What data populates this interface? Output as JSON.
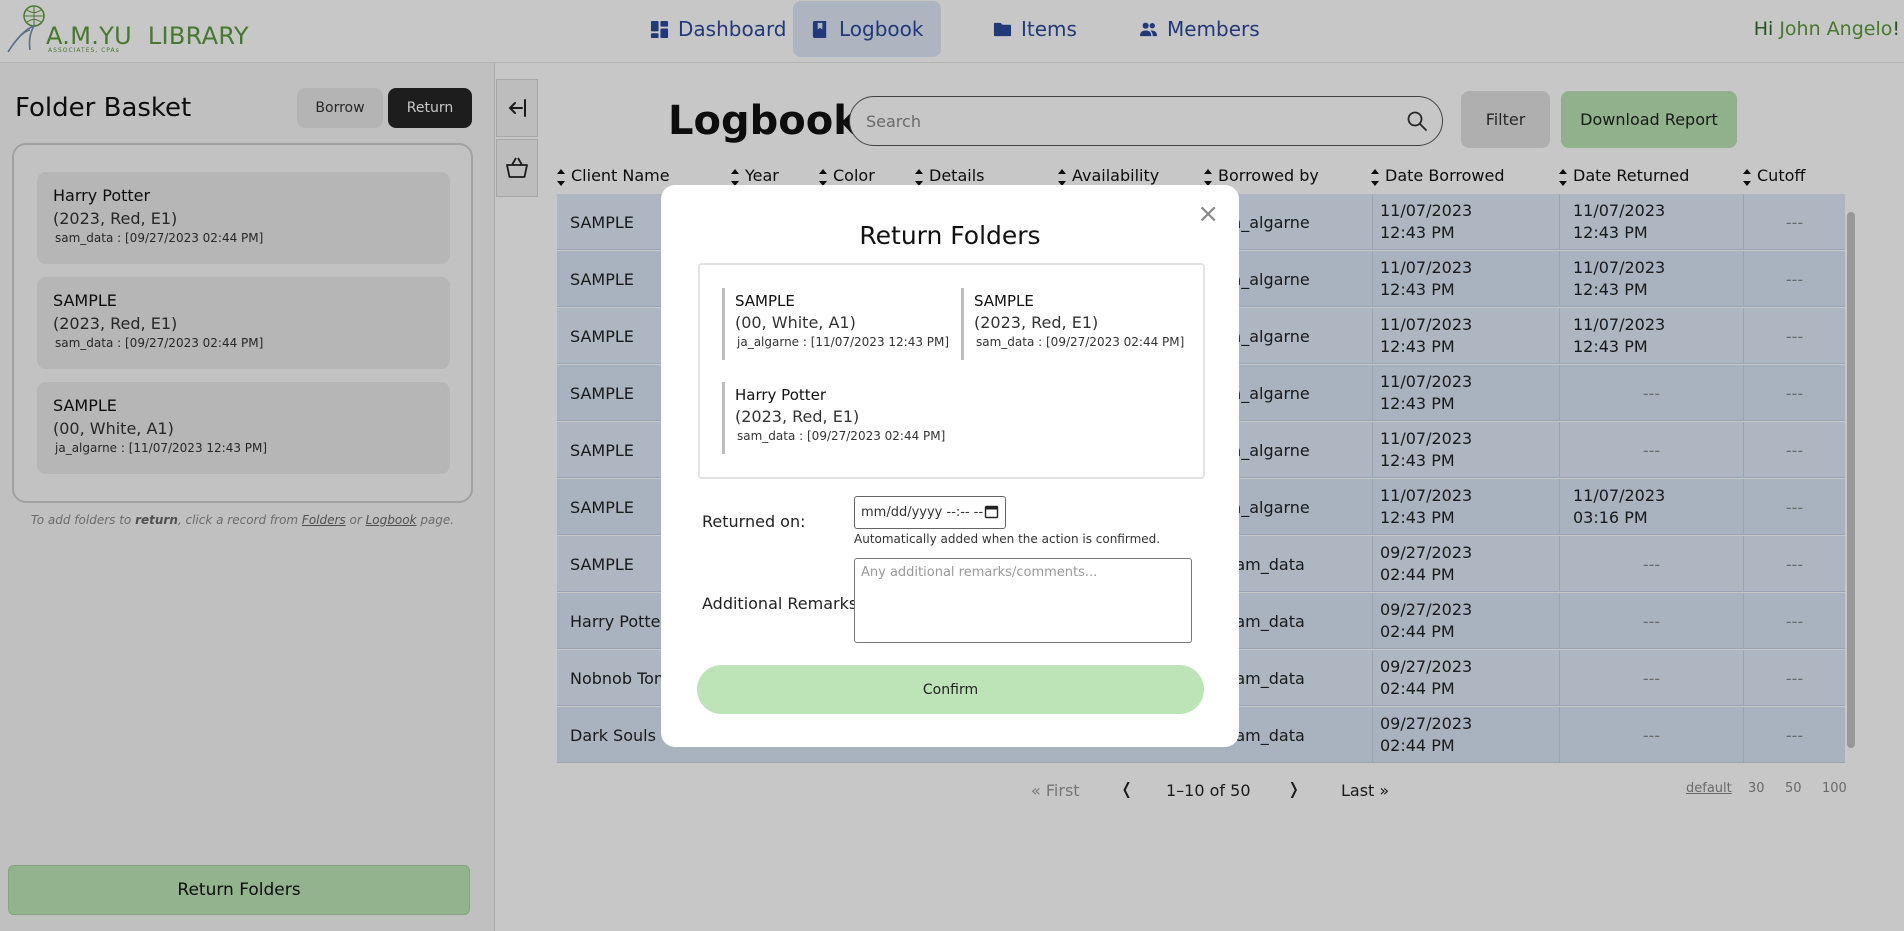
{
  "app": {
    "logo_text": "A.M.YU",
    "logo_library": "LIBRARY",
    "logo_sub": "ASSOCIATES, CPAs"
  },
  "nav": {
    "items": [
      {
        "label": "Dashboard",
        "icon": "dashboard-icon",
        "active": false
      },
      {
        "label": "Logbook",
        "icon": "book-bookmark-icon",
        "active": true
      },
      {
        "label": "Items",
        "icon": "folder-icon",
        "active": false
      },
      {
        "label": "Members",
        "icon": "users-icon",
        "active": false
      }
    ],
    "greeting_prefix": "Hi ",
    "user_name": "John Angelo",
    "greeting_suffix": "!"
  },
  "sidebar": {
    "title": "Folder Basket",
    "borrow_label": "Borrow",
    "return_label": "Return",
    "items": [
      {
        "title": "Harry Potter",
        "details": "(2023, Red, E1)",
        "meta": "sam_data : [09/27/2023 02:44 PM]"
      },
      {
        "title": "SAMPLE",
        "details": "(2023, Red, E1)",
        "meta": "sam_data : [09/27/2023 02:44 PM]"
      },
      {
        "title": "SAMPLE",
        "details": "(00, White, A1)",
        "meta": "ja_algarne : [11/07/2023 12:43 PM]"
      }
    ],
    "hint_a": "To add folders to ",
    "hint_b": "return",
    "hint_c": ", click a record from ",
    "hint_d": "Folders",
    "hint_e": " or ",
    "hint_f": "Logbook",
    "hint_g": " page.",
    "action_label": "Return Folders"
  },
  "main": {
    "title": "Logbook",
    "search_placeholder": "Search",
    "filter_label": "Filter",
    "download_label": "Download Report",
    "columns": [
      "Client Name",
      "Year",
      "Color",
      "Details",
      "Availability",
      "Borrowed by",
      "Date Borrowed",
      "Date Returned",
      "Cutoff"
    ],
    "rows": [
      {
        "client": "SAMPLE",
        "borrowed_by": "ja_algarne",
        "borrowed_date": "11/07/2023",
        "borrowed_time": "12:43 PM",
        "returned_date": "11/07/2023",
        "returned_time": "12:43 PM",
        "cutoff": "---"
      },
      {
        "client": "SAMPLE",
        "borrowed_by": "ja_algarne",
        "borrowed_date": "11/07/2023",
        "borrowed_time": "12:43 PM",
        "returned_date": "11/07/2023",
        "returned_time": "12:43 PM",
        "cutoff": "---"
      },
      {
        "client": "SAMPLE",
        "borrowed_by": "ja_algarne",
        "borrowed_date": "11/07/2023",
        "borrowed_time": "12:43 PM",
        "returned_date": "11/07/2023",
        "returned_time": "12:43 PM",
        "cutoff": "---"
      },
      {
        "client": "SAMPLE",
        "borrowed_by": "ja_algarne",
        "borrowed_date": "11/07/2023",
        "borrowed_time": "12:43 PM",
        "returned_date": "---",
        "returned_time": "",
        "cutoff": "---"
      },
      {
        "client": "SAMPLE",
        "borrowed_by": "ja_algarne",
        "borrowed_date": "11/07/2023",
        "borrowed_time": "12:43 PM",
        "returned_date": "---",
        "returned_time": "",
        "cutoff": "---"
      },
      {
        "client": "SAMPLE",
        "borrowed_by": "ja_algarne",
        "borrowed_date": "11/07/2023",
        "borrowed_time": "12:43 PM",
        "returned_date": "11/07/2023",
        "returned_time": "03:16 PM",
        "cutoff": "---"
      },
      {
        "client": "SAMPLE",
        "borrowed_by": "sam_data",
        "borrowed_date": "09/27/2023",
        "borrowed_time": "02:44 PM",
        "returned_date": "---",
        "returned_time": "",
        "cutoff": "---"
      },
      {
        "client": "Harry Potter",
        "borrowed_by": "sam_data",
        "borrowed_date": "09/27/2023",
        "borrowed_time": "02:44 PM",
        "returned_date": "---",
        "returned_time": "",
        "cutoff": "---"
      },
      {
        "client": "Nobnob Tom",
        "borrowed_by": "sam_data",
        "borrowed_date": "09/27/2023",
        "borrowed_time": "02:44 PM",
        "returned_date": "---",
        "returned_time": "",
        "cutoff": "---"
      },
      {
        "client": "Dark Souls",
        "borrowed_by": "sam_data",
        "borrowed_date": "09/27/2023",
        "borrowed_time": "02:44 PM",
        "returned_date": "---",
        "returned_time": "",
        "cutoff": "---"
      }
    ],
    "pagination": {
      "first": "« First",
      "prev": "❬",
      "range": "1–10  of  50",
      "next": "❭",
      "last": "Last »",
      "sizes": [
        "default",
        "30",
        "50",
        "100"
      ]
    }
  },
  "modal": {
    "title": "Return Folders",
    "close": "×",
    "items": [
      {
        "title": "SAMPLE",
        "details": "(00, White, A1)",
        "meta": "ja_algarne : [11/07/2023 12:43 PM]"
      },
      {
        "title": "SAMPLE",
        "details": "(2023, Red, E1)",
        "meta": "sam_data : [09/27/2023 02:44 PM]"
      },
      {
        "title": "Harry Potter",
        "details": "(2023, Red, E1)",
        "meta": "sam_data : [09/27/2023 02:44 PM]"
      }
    ],
    "returned_on_label": "Returned on:",
    "date_placeholder": "mm/dd/yyyy --:-- --",
    "auto_note": "Automatically added when the action is confirmed.",
    "remarks_label": "Additional Remarks:",
    "remarks_placeholder": "Any additional remarks/comments...",
    "confirm_label": "Confirm"
  },
  "colors": {
    "brand_green": "#5a9a3b",
    "nav_blue": "#2b4a9a",
    "table_row": "#dfeaf9",
    "button_green": "#bde4b7"
  }
}
